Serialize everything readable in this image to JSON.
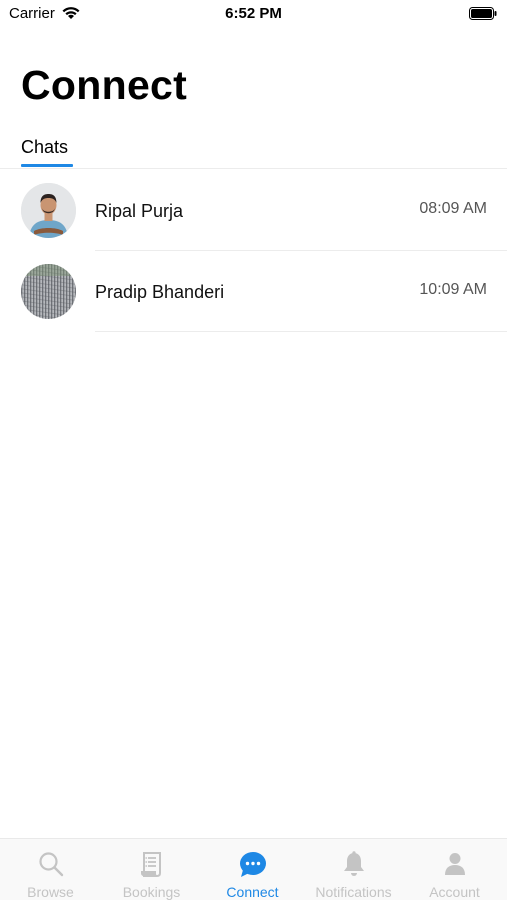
{
  "status_bar": {
    "carrier": "Carrier",
    "time": "6:52 PM"
  },
  "page": {
    "title": "Connect"
  },
  "tabs": [
    {
      "label": "Chats",
      "active": true
    }
  ],
  "chats": [
    {
      "name": "Ripal Purja",
      "time": "08:09 AM",
      "avatar_icon": "person-photo"
    },
    {
      "name": "Pradip Bhanderi",
      "time": "10:09 AM",
      "avatar_icon": "pattern-photo"
    }
  ],
  "tab_bar": {
    "items": [
      {
        "label": "Browse",
        "icon": "search-icon",
        "active": false
      },
      {
        "label": "Bookings",
        "icon": "receipt-icon",
        "active": false
      },
      {
        "label": "Connect",
        "icon": "chat-bubble-icon",
        "active": true
      },
      {
        "label": "Notifications",
        "icon": "bell-icon",
        "active": false
      },
      {
        "label": "Account",
        "icon": "person-icon",
        "active": false
      }
    ]
  },
  "colors": {
    "accent": "#1e88e5",
    "inactive": "#c4c4c4",
    "divider": "#ececec"
  }
}
